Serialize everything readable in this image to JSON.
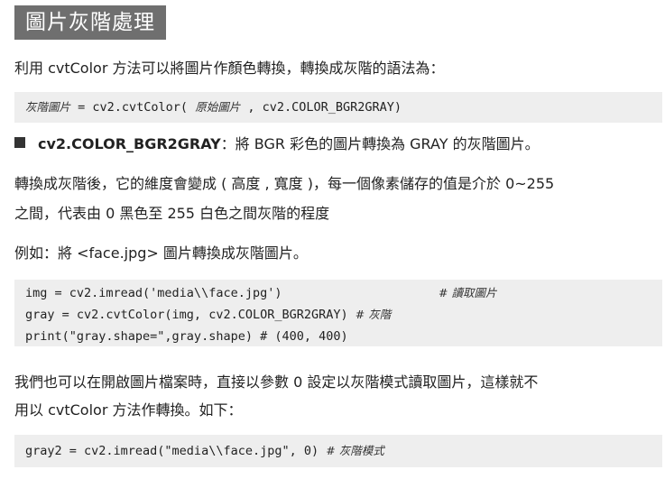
{
  "title": "圖片灰階處理",
  "intro": "利用 cvtColor 方法可以將圖片作顏色轉換，轉換成灰階的語法為：",
  "syntax": {
    "var": "灰階圖片",
    "eq": " = cv2.cvtColor( ",
    "arg": "原始圖片",
    "rest": " , cv2.COLOR_BGR2GRAY)"
  },
  "bullet": {
    "term": "cv2.COLOR_BGR2GRAY",
    "desc": "：將 BGR 彩色的圖片轉換為 GRAY 的灰階圖片。"
  },
  "para1": {
    "line1": "轉換成灰階後，它的維度會變成 ( 高度 , 寬度 )，每一個像素儲存的值是介於 0~255",
    "line2": "之間，代表由 0 黑色至 255 白色之間灰階的程度"
  },
  "example": "例如：將 <face.jpg> 圖片轉換成灰階圖片。",
  "code1": {
    "line1": "img = cv2.imread('media\\\\face.jpg')",
    "comment1": "# 讀取圖片",
    "line2": "gray = cv2.cvtColor(img, cv2.COLOR_BGR2GRAY) ",
    "comment2": "# 灰階",
    "line3": "print(\"gray.shape=\",gray.shape) # (400, 400)"
  },
  "para2": {
    "line1": "我們也可以在開啟圖片檔案時，直接以參數 0 設定以灰階模式讀取圖片，這樣就不",
    "line2": "用以 cvtColor 方法作轉換。如下："
  },
  "code2": {
    "line1": "gray2 = cv2.imread(\"media\\\\face.jpg\", 0) ",
    "comment1": "# 灰階模式"
  }
}
